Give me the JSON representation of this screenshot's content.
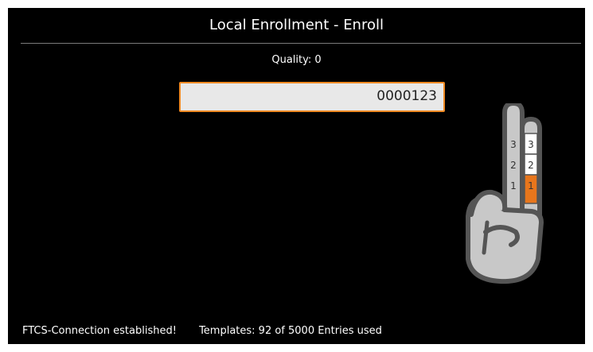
{
  "header": {
    "title": "Local Enrollment - Enroll"
  },
  "quality": {
    "label": "Quality:",
    "value": "0"
  },
  "id_field": {
    "value": "0000123"
  },
  "finger_guide": {
    "left_column_labels": [
      "3",
      "2",
      "1"
    ],
    "right_column_labels": [
      "3",
      "2",
      "1"
    ],
    "active_step": "1",
    "active_color": "#e8761c"
  },
  "status_bar": {
    "connection": "FTCS-Connection established!",
    "templates": "Templates: 92 of 5000 Entries used"
  }
}
